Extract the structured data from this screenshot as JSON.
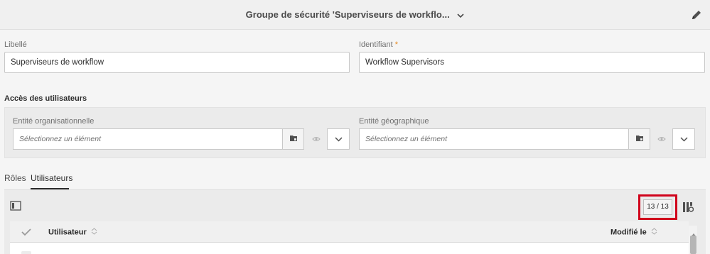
{
  "header": {
    "title": "Groupe de sécurité 'Superviseurs de workflo..."
  },
  "form": {
    "label_field": {
      "label": "Libellé",
      "value": "Superviseurs de workflow"
    },
    "id_field": {
      "label": "Identifiant",
      "required_mark": "*",
      "value": "Workflow Supervisors"
    }
  },
  "access": {
    "title": "Accès des utilisateurs",
    "org": {
      "label": "Entité organisationnelle",
      "placeholder": "Sélectionnez un élément"
    },
    "geo": {
      "label": "Entité géographique",
      "placeholder": "Sélectionnez un élément"
    }
  },
  "tabs": [
    {
      "label": "Rôles",
      "active": false
    },
    {
      "label": "Utilisateurs",
      "active": true
    }
  ],
  "grid": {
    "counter": "13 / 13",
    "columns": {
      "user": "Utilisateur",
      "modified": "Modifié le"
    }
  },
  "colors": {
    "highlight": "#d0021b",
    "required": "#e68619"
  }
}
